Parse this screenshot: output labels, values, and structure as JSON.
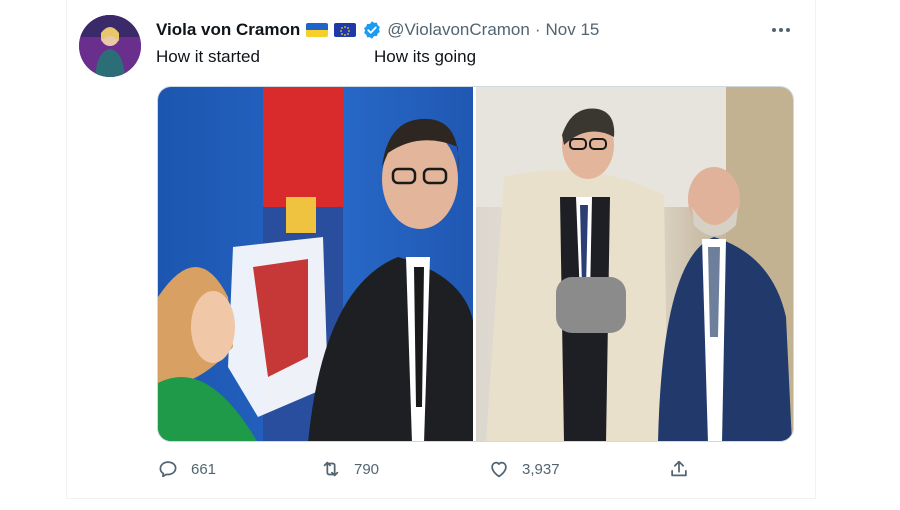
{
  "tweet": {
    "author_name": "Viola von Cramon",
    "handle": "@ViolavonCramon",
    "separator": "·",
    "date": "Nov 15",
    "caption_left": "How it started",
    "caption_right": "How its going",
    "flags": [
      "flag-ukraine-icon",
      "flag-eu-icon"
    ],
    "verified": "verified-badge-icon",
    "accent": "#1d9bf0"
  },
  "actions": {
    "replies": "661",
    "retweets": "790",
    "likes": "3,937"
  }
}
